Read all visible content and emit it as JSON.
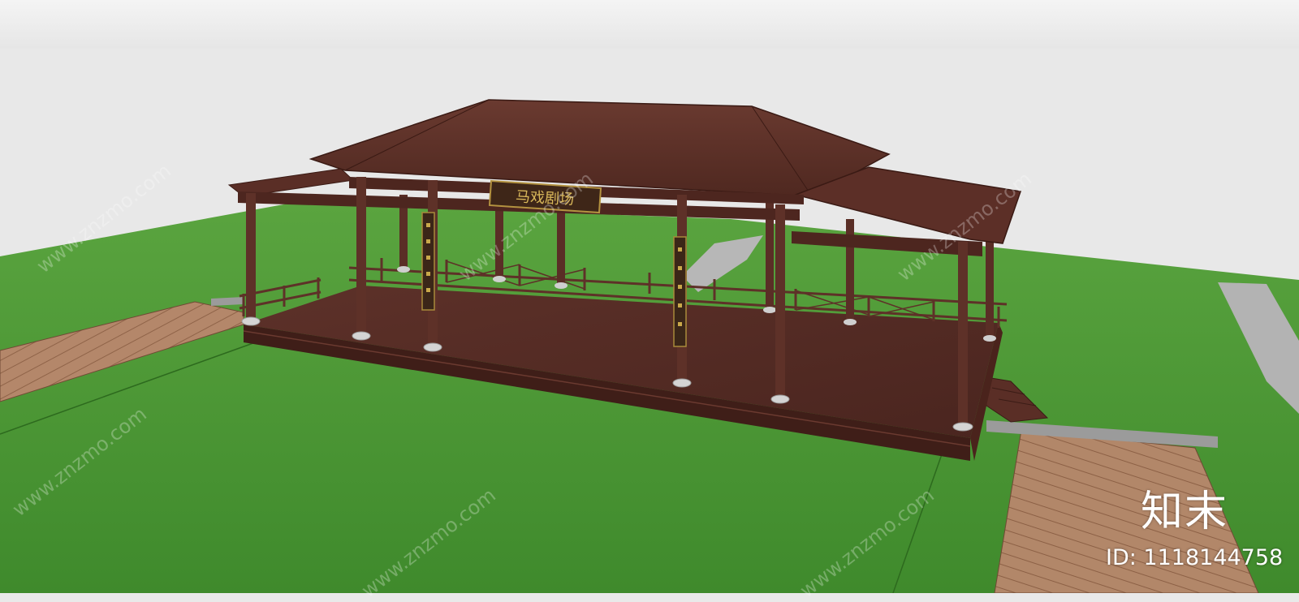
{
  "plaque": {
    "text": "马戏剧场"
  },
  "watermark": {
    "site": "www.znzmo.com",
    "brand": "知末",
    "id_label": "ID: 1118144758"
  },
  "colors": {
    "sky": "#e9e9e9",
    "grass": "#4f9a38",
    "wood_dark": "#5a2f27",
    "wood_light": "#a77b59",
    "stone_path": "#b3b3b3"
  }
}
